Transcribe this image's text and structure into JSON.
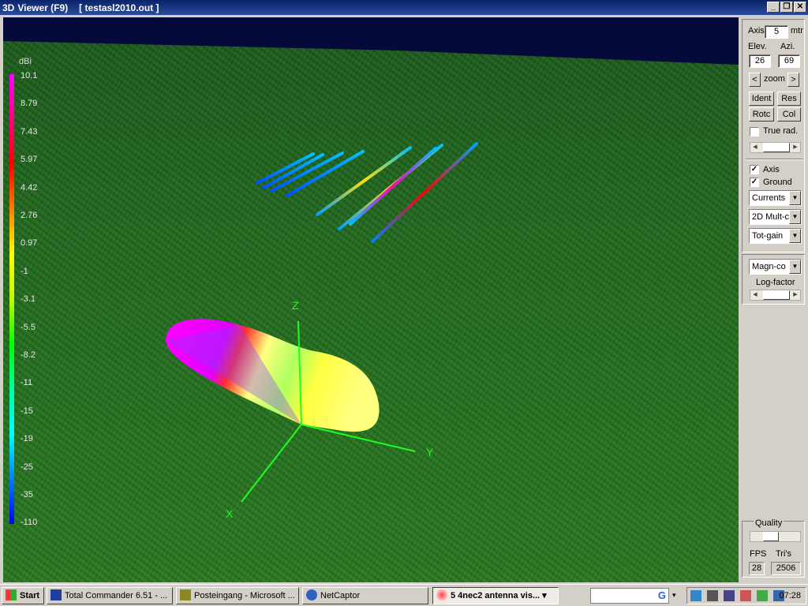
{
  "window": {
    "title": "Viewer (F9)",
    "file": "[  testasl2010.out ]",
    "icon": "3D"
  },
  "legend": {
    "unit": "dBi",
    "values": [
      "10.1",
      "8.79",
      "7.43",
      "5.97",
      "4.42",
      "2.76",
      "0.97",
      "-1",
      "-3.1",
      "-5.5",
      "-8.2",
      "-11",
      "-15",
      "-19",
      "-25",
      "-35",
      "-110"
    ]
  },
  "axes": {
    "x": "X",
    "y": "Y",
    "z": "Z"
  },
  "panel": {
    "axis_label": "Axis",
    "axis_value": "5",
    "axis_unit": "mtr",
    "elev_label": "Elev.",
    "azi_label": "Azi.",
    "elev_value": "26",
    "azi_value": "69",
    "zoom_label": "zoom",
    "zoom_left": "<",
    "zoom_right": ">",
    "ident": "Ident",
    "res": "Res",
    "rotc": "Rotc",
    "col": "Col",
    "true_rad": "True rad.",
    "true_rad_checked": false,
    "axis_check": "Axis",
    "axis_checked": true,
    "ground_check": "Ground",
    "ground_checked": true,
    "select1": "Currents",
    "select2": "2D Mult-c",
    "select3": "Tot-gain",
    "select4": "Magn-co",
    "log_factor": "Log-factor",
    "quality": "Quality",
    "fps_label": "FPS",
    "tris_label": "Tri's",
    "fps_value": "28",
    "tris_value": "2506"
  },
  "taskbar": {
    "start": "Start",
    "items": [
      "Total Commander 6.51 - ...",
      "Posteingang - Microsoft ...",
      "NetCaptor",
      "5 4nec2 antenna vis..."
    ],
    "clock": "07:28"
  }
}
